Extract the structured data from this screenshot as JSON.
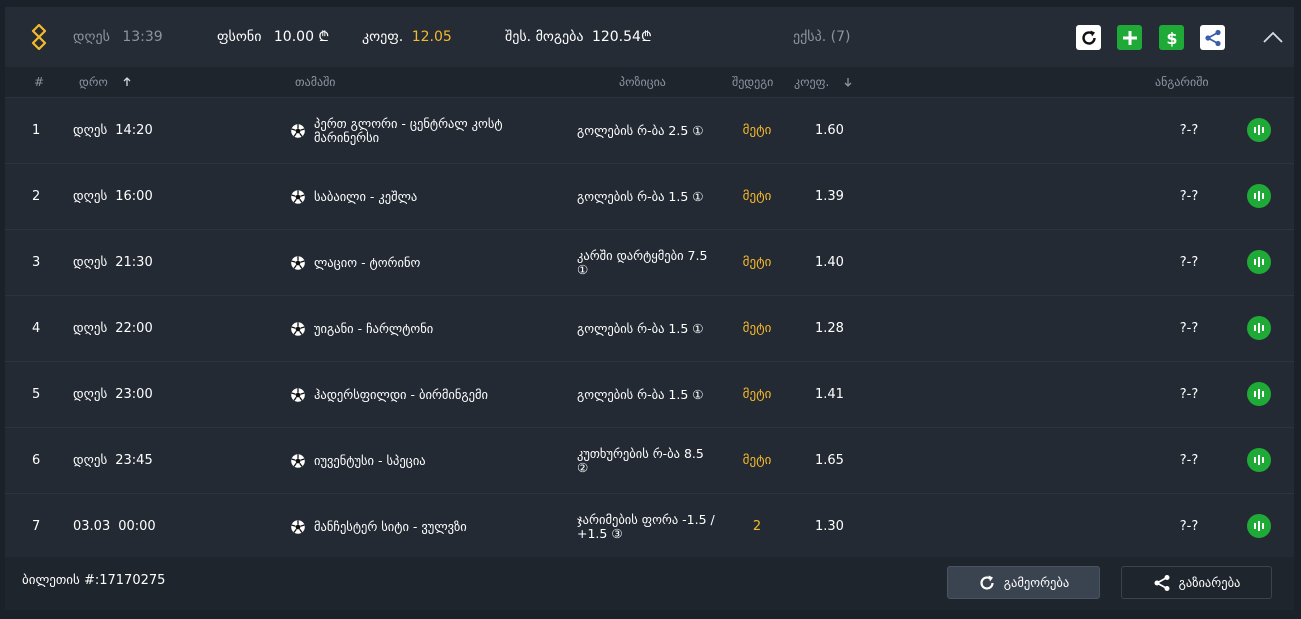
{
  "header": {
    "day": "დღეს",
    "time": "13:39",
    "stake_label": "ფსონი",
    "stake_value": "10.00 ₾",
    "odds_label": "კოეფ.",
    "odds_value": "12.05",
    "winnings_label": "შეს. მოგება",
    "winnings_value": "120.54₾",
    "type": "ექსპ. (7)"
  },
  "columns": {
    "num": "#",
    "date": "დრო",
    "game": "თამაში",
    "position": "პოზიცია",
    "result": "შედეგი",
    "odds": "კოეფ.",
    "account": "ანგარიში"
  },
  "rows": [
    {
      "num": "1",
      "day": "დღეს",
      "time": "14:20",
      "game": "პერთ გლორი - ცენტრალ კოსტ მარინერსი",
      "position": "გოლების რ-ბა 2.5 ①",
      "result": "მეტი",
      "odds": "1.60",
      "score": "?-?"
    },
    {
      "num": "2",
      "day": "დღეს",
      "time": "16:00",
      "game": "საბაილი - კეშლა",
      "position": "გოლების რ-ბა 1.5 ①",
      "result": "მეტი",
      "odds": "1.39",
      "score": "?-?"
    },
    {
      "num": "3",
      "day": "დღეს",
      "time": "21:30",
      "game": "ლაციო - ტორინო",
      "position": "კარში დარტყმები 7.5 ①",
      "result": "მეტი",
      "odds": "1.40",
      "score": "?-?"
    },
    {
      "num": "4",
      "day": "დღეს",
      "time": "22:00",
      "game": "უიგანი - ჩარლტონი",
      "position": "გოლების რ-ბა 1.5 ①",
      "result": "მეტი",
      "odds": "1.28",
      "score": "?-?"
    },
    {
      "num": "5",
      "day": "დღეს",
      "time": "23:00",
      "game": "ჰადერსფილდი - ბირმინგემი",
      "position": "გოლების რ-ბა 1.5 ①",
      "result": "მეტი",
      "odds": "1.41",
      "score": "?-?"
    },
    {
      "num": "6",
      "day": "დღეს",
      "time": "23:45",
      "game": "იუვენტუსი - სპეცია",
      "position": "კუთხურების რ-ბა 8.5 ②",
      "result": "მეტი",
      "odds": "1.65",
      "score": "?-?"
    },
    {
      "num": "7",
      "day": "03.03",
      "time": "00:00",
      "game": "მანჩესტერ სიტი - ვულვზი",
      "position": "ჯარიმების ფორა -1.5 / +1.5 ③",
      "result": "2",
      "odds": "1.30",
      "score": "?-?"
    }
  ],
  "footer": {
    "ticket": "ბილეთის #:17170275",
    "repeat_label": "გამეორება",
    "share_label": "გაზიარება"
  },
  "colors": {
    "accent": "#f6b92b",
    "green": "#1faa37",
    "background": "#1f252d"
  }
}
